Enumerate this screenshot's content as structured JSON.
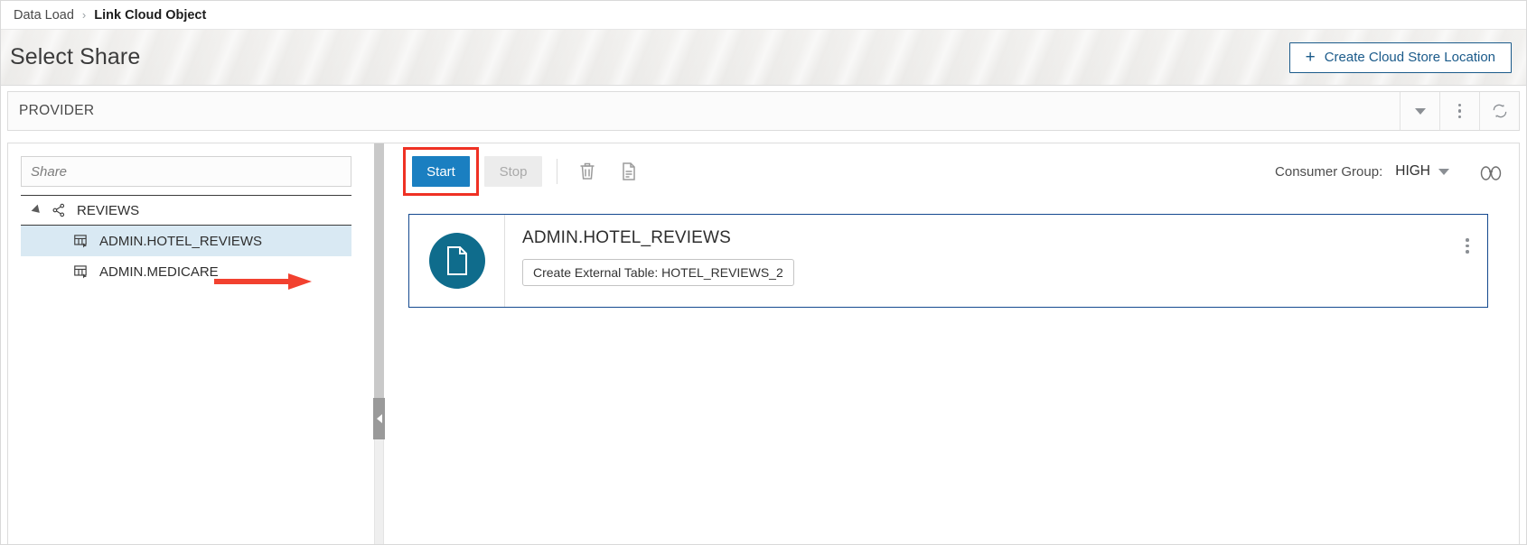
{
  "breadcrumb": {
    "parent": "Data Load",
    "separator": "›",
    "current": "Link Cloud Object"
  },
  "header": {
    "title": "Select Share",
    "create_button": {
      "label": "Create Cloud Store Location",
      "plus": "+",
      "icon": "plus-icon",
      "accent_color": "#1a5a8a"
    }
  },
  "provider_bar": {
    "label": "PROVIDER",
    "dropdown_icon": "chevron-down-icon",
    "menu_icon": "vertical-dots-icon",
    "refresh_icon": "refresh-icon"
  },
  "left_panel": {
    "search": {
      "value": "",
      "placeholder": "Share"
    },
    "tree": [
      {
        "label": "REVIEWS",
        "level": 0,
        "expanded": true,
        "icon": "share-network-icon",
        "twisty_icon": "triangle-expanded-icon",
        "selected": false
      },
      {
        "label": "ADMIN.HOTEL_REVIEWS",
        "level": 1,
        "icon": "table-link-icon",
        "selected": true
      },
      {
        "label": "ADMIN.MEDICARE",
        "level": 1,
        "icon": "table-link-icon",
        "selected": false
      }
    ]
  },
  "splitter": {
    "collapse_icon": "collapse-left-icon"
  },
  "toolbar": {
    "start_label": "Start",
    "stop_label": "Stop",
    "start_highlighted": true,
    "highlight_color": "#ef3124",
    "start_color": "#1a7fc1",
    "delete_icon": "trash-icon",
    "preview_icon": "document-icon",
    "consumer_group_label": "Consumer Group:",
    "consumer_group_value": "HIGH",
    "consumer_group_caret": "chevron-down-icon",
    "inspect_icon": "binoculars-icon"
  },
  "card": {
    "icon": "file-document-icon",
    "icon_bg": "#0f6c8c",
    "border_color": "#14498f",
    "title": "ADMIN.HOTEL_REVIEWS",
    "chip_label": "Create External Table: HOTEL_REVIEWS_2",
    "menu_icon": "vertical-dots-icon"
  },
  "annotation": {
    "arrow_icon": "red-arrow-right",
    "color": "#f2412f"
  }
}
